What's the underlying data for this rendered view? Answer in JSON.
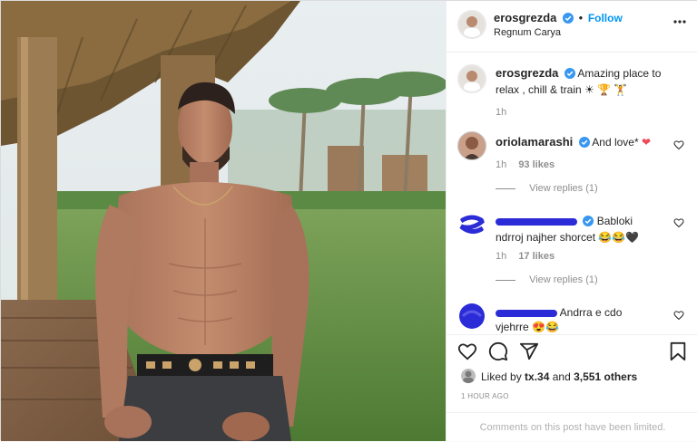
{
  "post": {
    "author": "erosgrezda",
    "follow_label": "Follow",
    "dot": "•",
    "location": "Regnum Carya",
    "more_icon": "more-dots-icon"
  },
  "caption": {
    "author": "erosgrezda",
    "text": "Amazing place to relax , chill & train",
    "emoji": "☀ 🏆 🏋",
    "time": "1h"
  },
  "comments": [
    {
      "author": "oriolamarashi",
      "text": "And love*",
      "emoji": "❤",
      "time": "1h",
      "likes": "93 likes",
      "view_replies": "View replies (1)"
    },
    {
      "author": "",
      "text_line1": "Babloki",
      "text_line2": "ndrroj najher shorcet",
      "emoji": "😂😂🖤",
      "time": "1h",
      "likes": "17 likes",
      "view_replies": "View replies (1)"
    },
    {
      "author": "",
      "text_line1": "Andrra e cdo",
      "text_line2": "vjehrre",
      "emoji": "😍😂"
    }
  ],
  "likes": {
    "prefix": "Liked by",
    "user": "tx.34",
    "joiner": "and",
    "others": "3,551 others"
  },
  "timestamp": "1 HOUR AGO",
  "comments_limited": "Comments on this post have been limited.",
  "colors": {
    "accent": "#0095f6",
    "verified": "#3897f0",
    "heart": "#ed4956",
    "muted": "#8e8e8e"
  }
}
